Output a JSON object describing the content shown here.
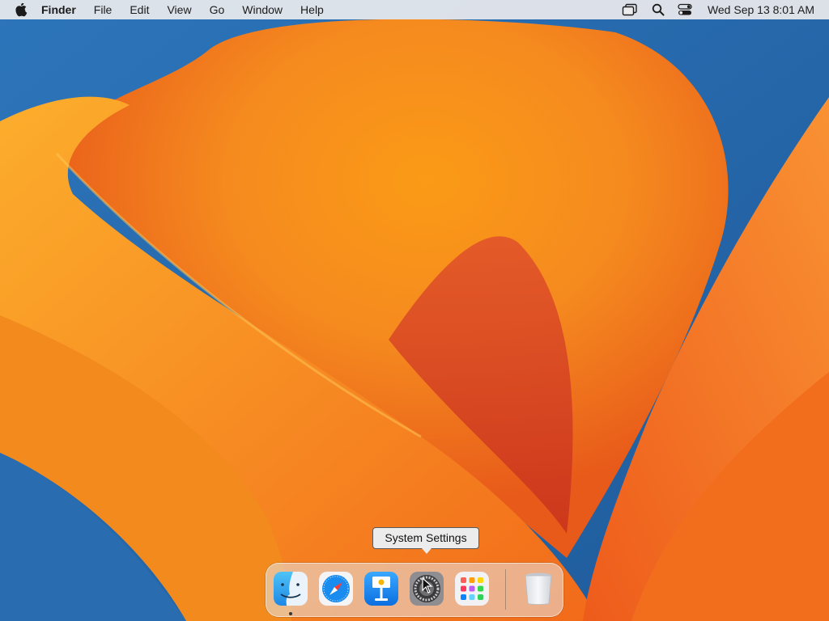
{
  "menubar": {
    "app_name": "Finder",
    "menus": [
      "File",
      "Edit",
      "View",
      "Go",
      "Window",
      "Help"
    ],
    "status_icons": [
      "screen-mirroring-icon",
      "spotlight-search-icon",
      "control-center-icon"
    ],
    "clock": "Wed Sep 13  8:01 AM"
  },
  "dock": {
    "apps": [
      {
        "name": "Finder",
        "icon": "finder-icon",
        "running": true
      },
      {
        "name": "Safari",
        "icon": "safari-icon",
        "running": false
      },
      {
        "name": "Keynote",
        "icon": "keynote-icon",
        "running": false
      },
      {
        "name": "System Settings",
        "icon": "system-settings-icon",
        "running": false
      },
      {
        "name": "Launchpad",
        "icon": "launchpad-icon",
        "running": false
      }
    ],
    "trash": {
      "name": "Trash",
      "icon": "trash-icon"
    }
  },
  "tooltip": {
    "text": "System Settings"
  },
  "colors": {
    "wallpaper_orange": "#f7941d",
    "wallpaper_blue": "#2f6fb2",
    "menubar": "#ececee"
  }
}
